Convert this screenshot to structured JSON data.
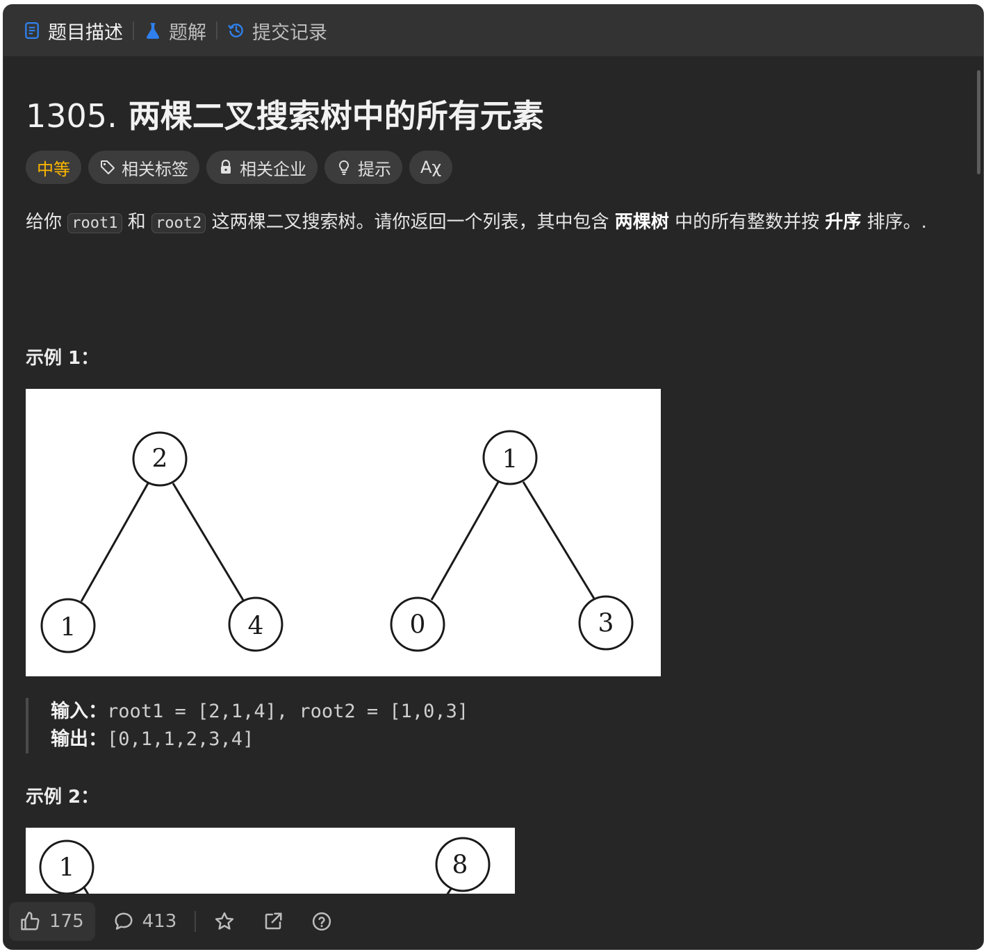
{
  "tabs": {
    "description": "题目描述",
    "solutions": "题解",
    "submissions": "提交记录"
  },
  "problem": {
    "number": "1305.",
    "title": "两棵二叉搜索树中的所有元素"
  },
  "tags": {
    "difficulty": "中等",
    "related_tags": "相关标签",
    "related_companies": "相关企业",
    "hint": "提示",
    "translate": "Aχ"
  },
  "description": {
    "p1": "给你 ",
    "code1": "root1",
    "p2": " 和 ",
    "code2": "root2",
    "p3": " 这两棵二叉搜索树。请你返回一个列表，其中包含 ",
    "b1": "两棵树",
    "p4": " 中的所有整数并按 ",
    "b2": "升序",
    "p5": " 排序。."
  },
  "example1": {
    "title": "示例 1：",
    "tree1": {
      "root": "2",
      "left": "1",
      "right": "4"
    },
    "tree2": {
      "root": "1",
      "left": "0",
      "right": "3"
    },
    "input_label": "输入：",
    "input_value": "root1 = [2,1,4], root2 = [1,0,3]",
    "output_label": "输出：",
    "output_value": "[0,1,1,2,3,4]"
  },
  "example2": {
    "title": "示例 2：",
    "tree1_root": "1",
    "tree2_root": "8"
  },
  "footer": {
    "likes": "175",
    "comments": "413"
  },
  "colors": {
    "background": "#262626",
    "tabbar": "#333333",
    "difficulty_medium": "#ffb800",
    "tab_icon_blue": "#2f80ed"
  }
}
